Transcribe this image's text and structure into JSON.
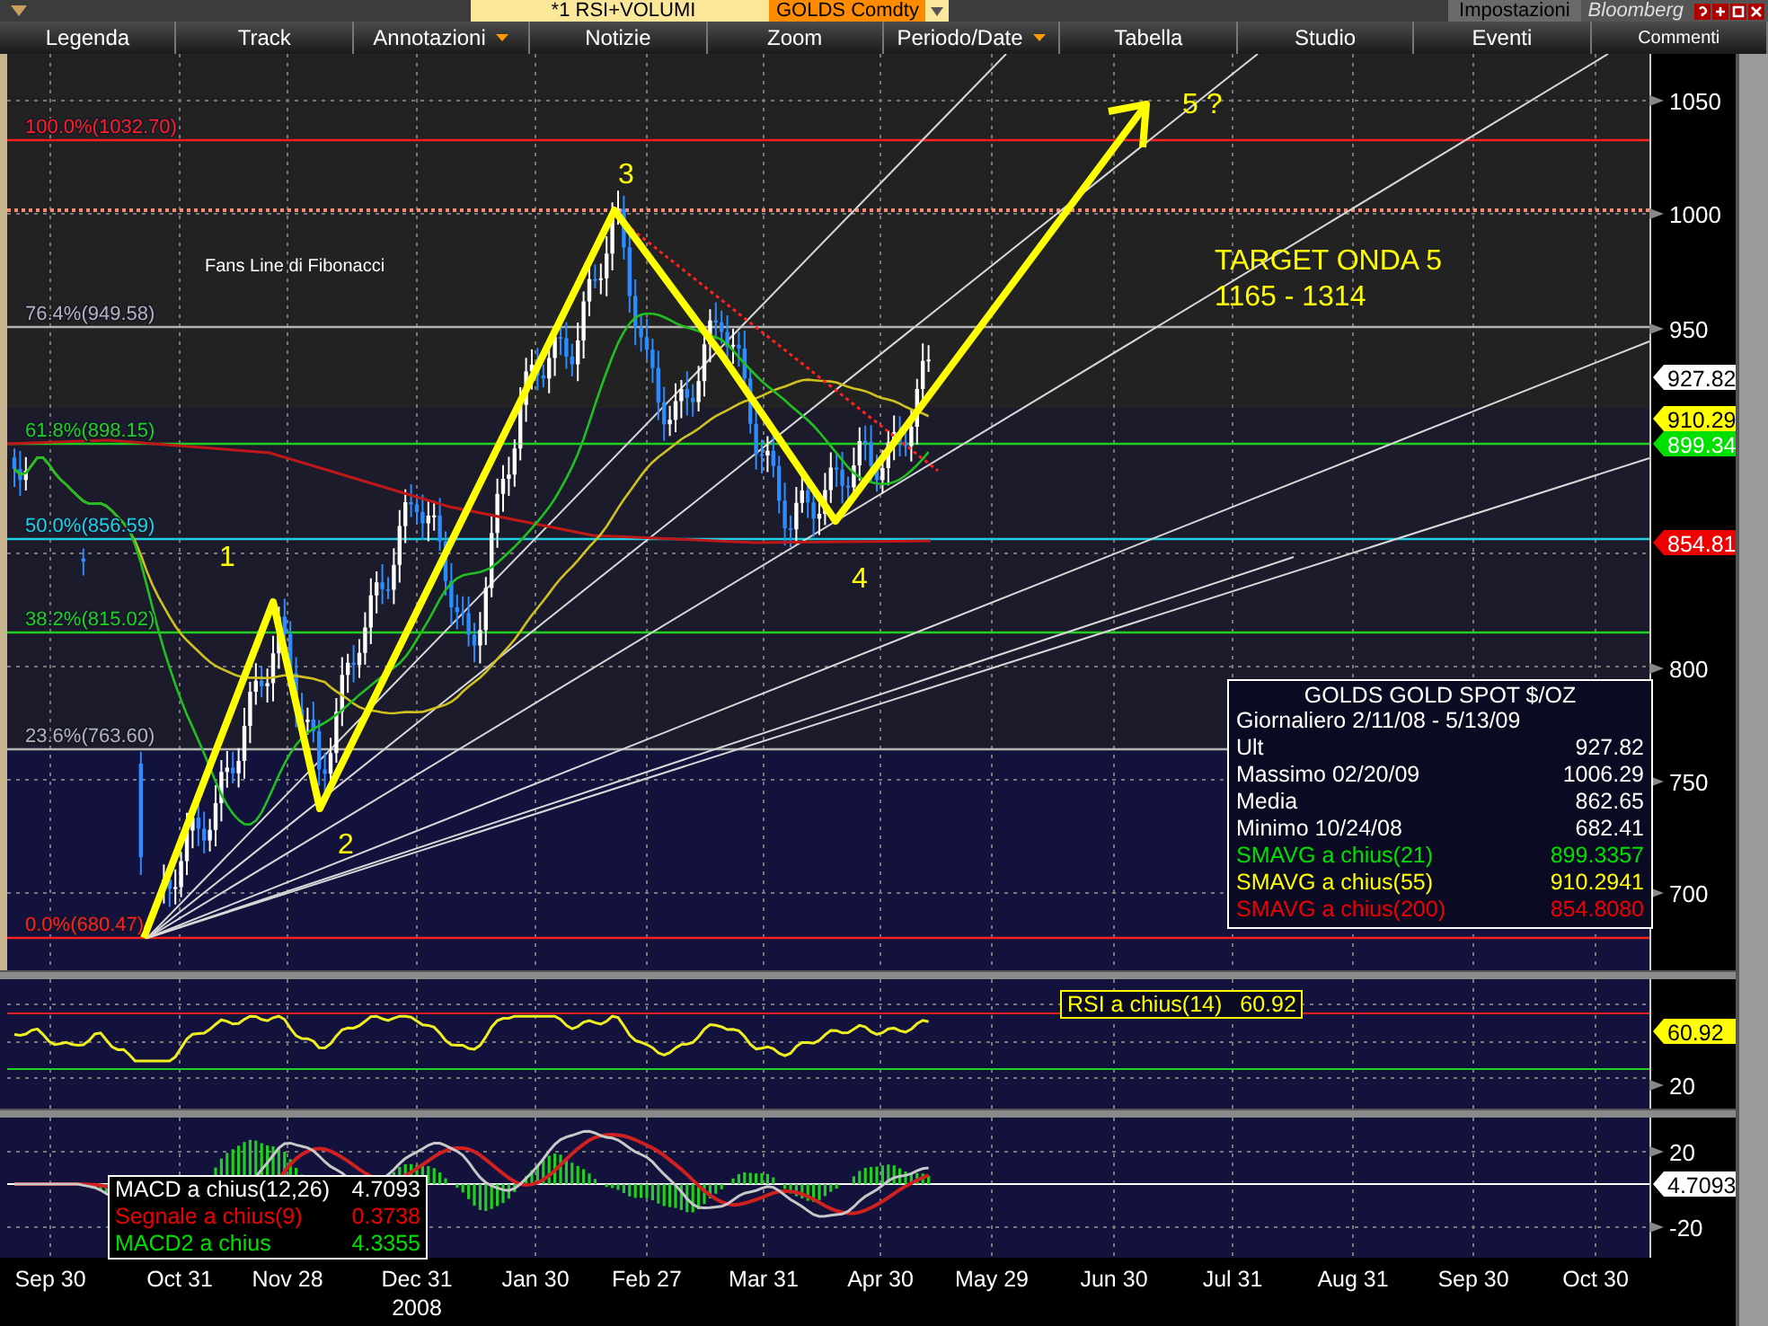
{
  "title_bar": {
    "study": "*1 RSI+VOLUMI",
    "security": "GOLDS Comdty",
    "settings": "Impostazioni",
    "brand": "Bloomberg"
  },
  "toolbar": [
    {
      "label": "Legenda",
      "dropdown": false
    },
    {
      "label": "Track",
      "dropdown": false
    },
    {
      "label": "Annotazioni",
      "dropdown": true
    },
    {
      "label": "Notizie",
      "dropdown": false
    },
    {
      "label": "Zoom",
      "dropdown": false
    },
    {
      "label": "Periodo/Date",
      "dropdown": true
    },
    {
      "label": "Tabella",
      "dropdown": false
    },
    {
      "label": "Studio",
      "dropdown": false
    },
    {
      "label": "Eventi",
      "dropdown": false
    },
    {
      "label": "Commenti",
      "dropdown": false
    }
  ],
  "price_panel": {
    "note": "Fans Line di Fibonacci",
    "fib_levels": [
      {
        "label": "100.0%(1032.70)",
        "color": "#ff2020"
      },
      {
        "label": "76.4%(949.58)",
        "color": "#b4b4b4"
      },
      {
        "label": "61.8%(898.15)",
        "color": "#20d020"
      },
      {
        "label": "50.0%(856.59)",
        "color": "#20d0e0"
      },
      {
        "label": "38.2%(815.02)",
        "color": "#20d020"
      },
      {
        "label": "23.6%(763.60)",
        "color": "#b4b4b4"
      },
      {
        "label": "0.0%(680.47)",
        "color": "#ff2020"
      }
    ],
    "waves": [
      "1",
      "2",
      "3",
      "4",
      "5 ?"
    ],
    "target": [
      "TARGET ONDA 5",
      "1165 - 1314"
    ],
    "y_axis": [
      "1050",
      "1000",
      "950",
      "800",
      "750",
      "700"
    ],
    "price_tags": [
      {
        "value": "927.82",
        "color": "#ffffff"
      },
      {
        "value": "910.29",
        "color": "#ffff00"
      },
      {
        "value": "899.34",
        "color": "#00e000"
      },
      {
        "value": "854.81",
        "color": "#ee0000"
      }
    ],
    "legend": {
      "title": "GOLDS  GOLD SPOT $/OZ",
      "period": "Giornaliero 2/11/08 - 5/13/09",
      "rows": [
        {
          "label": "Ult",
          "value": "927.82",
          "color": "#ffffff"
        },
        {
          "label": "Massimo  02/20/09",
          "value": "1006.29",
          "color": "#ffffff"
        },
        {
          "label": "Media",
          "value": "862.65",
          "color": "#ffffff"
        },
        {
          "label": "Minimo  10/24/08",
          "value": "682.41",
          "color": "#ffffff"
        },
        {
          "label": "SMAVG a chius(21)",
          "value": "899.3357",
          "color": "#00e000"
        },
        {
          "label": "SMAVG a chius(55)",
          "value": "910.2941",
          "color": "#ffff00"
        },
        {
          "label": "SMAVG a chius(200)",
          "value": "854.8080",
          "color": "#ee0000"
        }
      ]
    }
  },
  "rsi_panel": {
    "label": "RSI a chius(14)",
    "value": "60.92",
    "axis": [
      {
        "text": "60.92",
        "kind": "tag",
        "color": "#ffff00"
      },
      {
        "text": "20",
        "kind": "tick"
      }
    ]
  },
  "macd_panel": {
    "legend": [
      {
        "label": "MACD a chius(12,26)",
        "value": "4.7093",
        "color": "#ffffff"
      },
      {
        "label": "Segnale a chius(9)",
        "value": "0.3738",
        "color": "#ee0000"
      },
      {
        "label": "MACD2 a chius",
        "value": "4.3355",
        "color": "#00e000"
      }
    ],
    "axis": [
      {
        "text": "20",
        "kind": "tick"
      },
      {
        "text": "4.7093",
        "kind": "tag",
        "color": "#ffffff"
      },
      {
        "text": "-20",
        "kind": "tick"
      }
    ]
  },
  "x_axis": {
    "dates": [
      "Sep 30",
      "Oct 31",
      "Nov 28",
      "Dec 31",
      "Jan 30",
      "Feb 27",
      "Mar 31",
      "Apr 30",
      "May 29",
      "Jun 30",
      "Jul 31",
      "Aug 31",
      "Sep 30",
      "Oct 30"
    ],
    "year": "2008"
  }
}
